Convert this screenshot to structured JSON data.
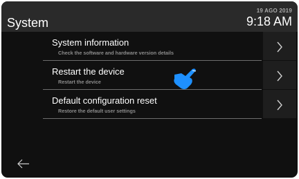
{
  "header": {
    "title": "System",
    "date": "19 AGO 2019",
    "time": "9:18 AM"
  },
  "menu": {
    "items": [
      {
        "label": "System information",
        "description": "Check the software and hardware version details"
      },
      {
        "label": "Restart the device",
        "description": "Restart the device"
      },
      {
        "label": "Default configuration reset",
        "description": "Restore the default user settings"
      }
    ]
  },
  "icons": {
    "chevron": "chevron-right-icon",
    "back": "back-arrow-icon",
    "pointer": "hand-pointer-icon"
  },
  "colors": {
    "background": "#101010",
    "header": "#2a2a2a",
    "pointer_accent": "#1e90ff"
  }
}
